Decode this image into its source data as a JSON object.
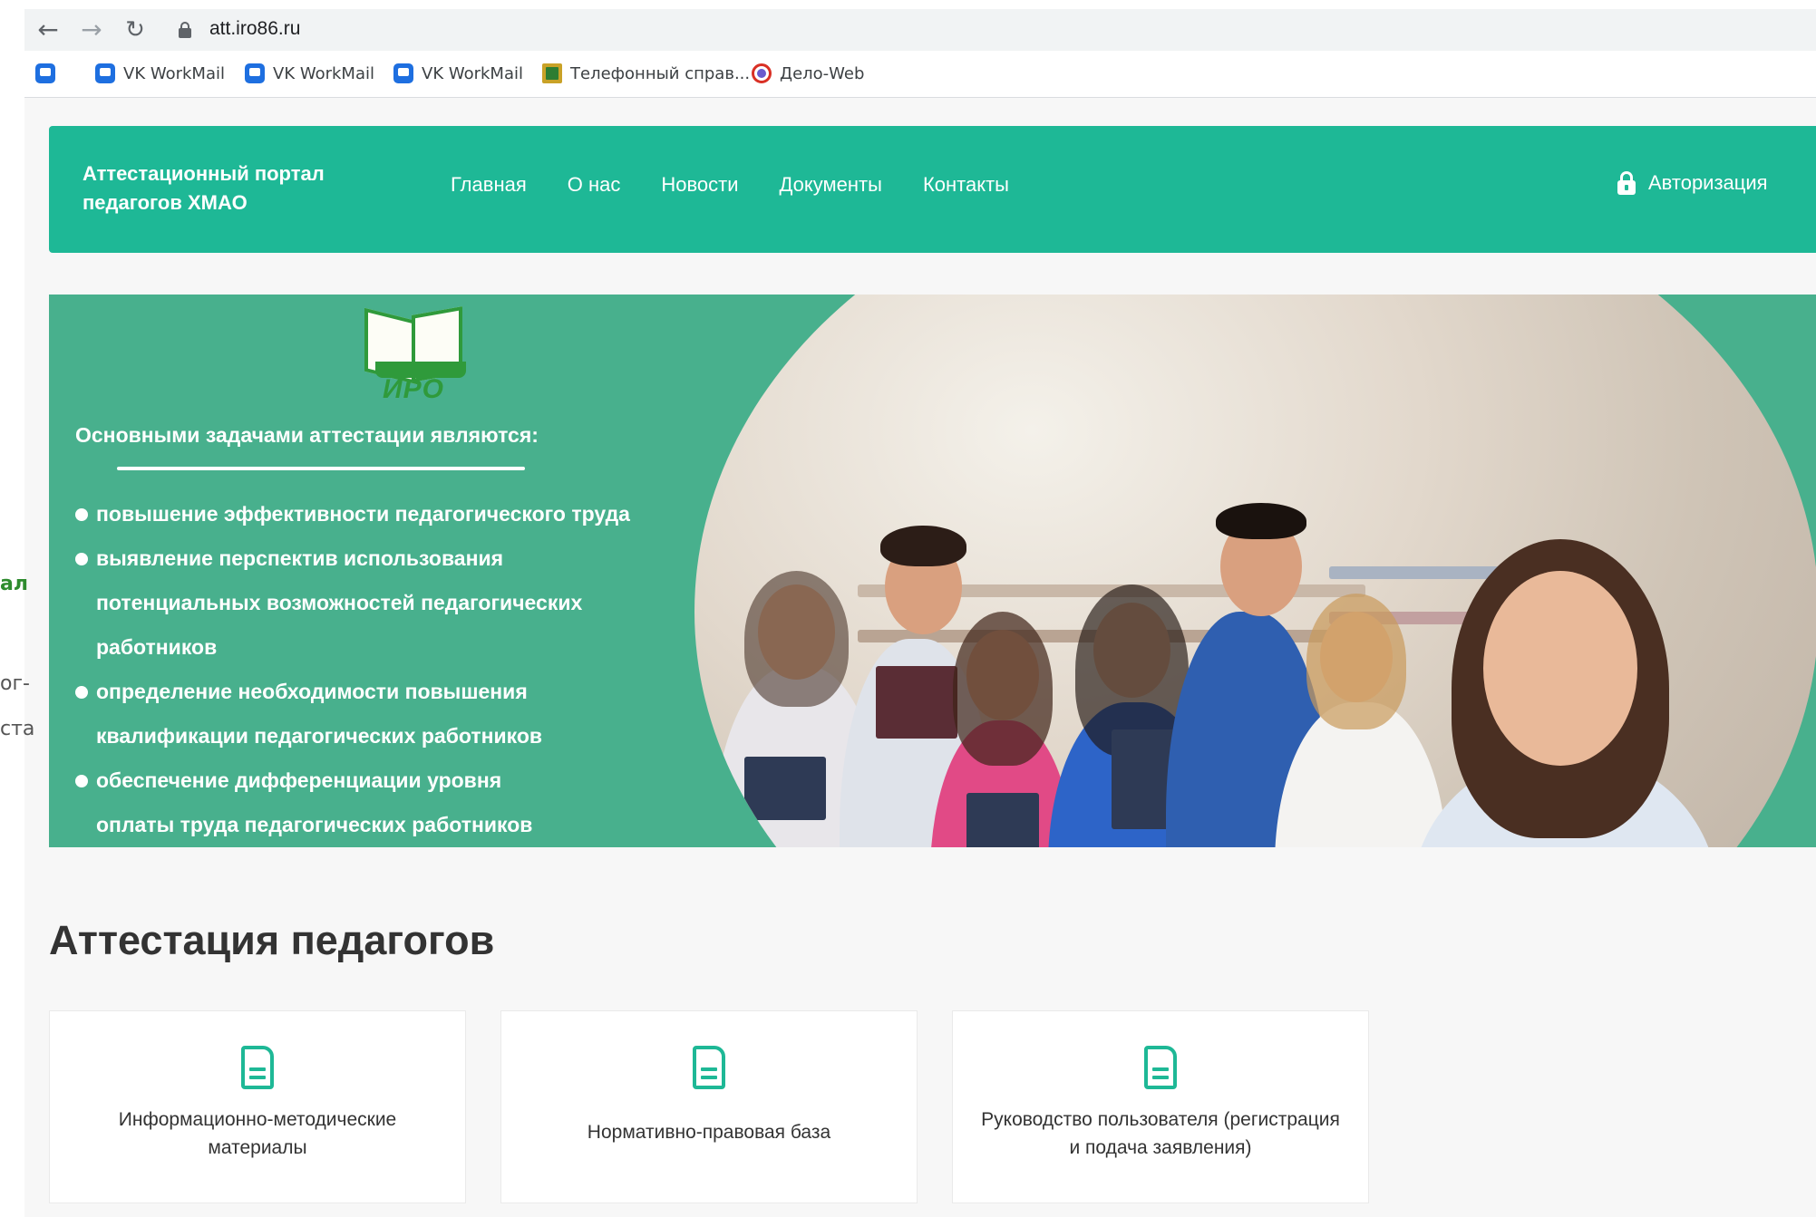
{
  "browser": {
    "url": "att.iro86.ru",
    "bookmarks": [
      "VK WorkMail",
      "VK WorkMail",
      "VK WorkMail",
      "Телефонный справ...",
      "Дело-Web"
    ]
  },
  "background_window": {
    "fragments": [
      "ал",
      "ог-",
      "ста"
    ]
  },
  "site": {
    "brand_line1": "Аттестационный портал",
    "brand_line2": "педагогов ХМАО",
    "menu": [
      "Главная",
      "О нас",
      "Новости",
      "Документы",
      "Контакты"
    ],
    "auth_label": "Авторизация"
  },
  "banner": {
    "logo_text": "ИРО",
    "tasks_title": "Основными задачами аттестации являются:",
    "tasks": [
      "повышение эффективности педагогического труда",
      "выявление перспектив использования потенциальных возможностей педагогических работников",
      "определение необходимости повышения квалификации педагогических работников",
      "обеспечение дифференциации уровня оплаты труда педагогических работников"
    ]
  },
  "section": {
    "title": "Аттестация педагогов",
    "cards": [
      "Информационно-методические материалы",
      "Нормативно-правовая база",
      "Руководство пользователя (регистрация и подача заявления)"
    ]
  },
  "colors": {
    "brand_green": "#1eb896",
    "banner_green": "#48b08d",
    "logo_green": "#2f9a3b"
  },
  "icons": {
    "back": "arrow-left-icon",
    "forward": "arrow-right-icon",
    "reload": "reload-icon",
    "lock": "lock-icon",
    "auth": "unlocked-padlock-icon",
    "card": "document-icon"
  }
}
